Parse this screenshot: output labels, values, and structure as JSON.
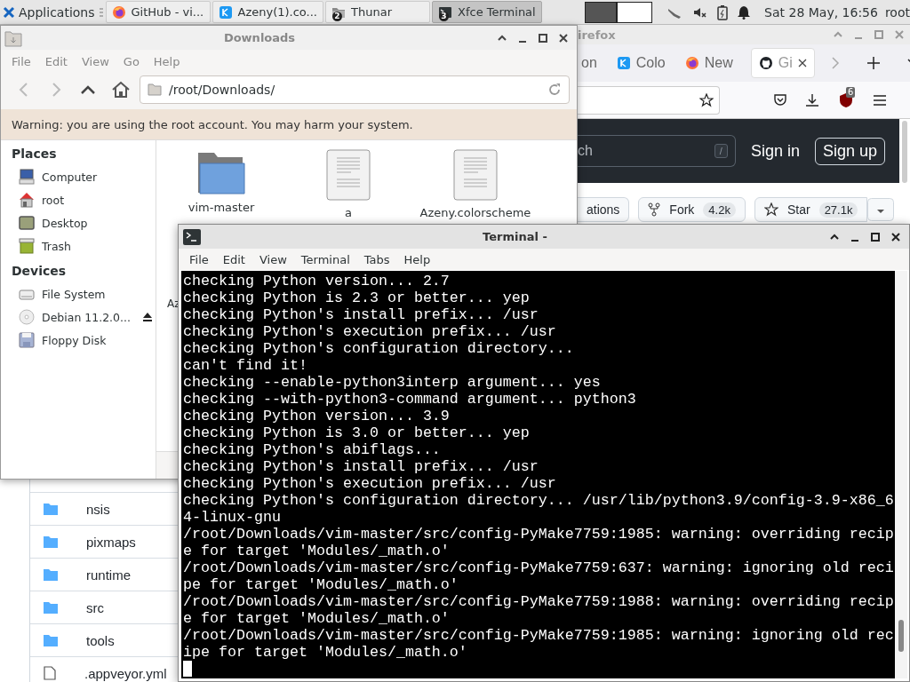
{
  "panel": {
    "menu_label": "Applications",
    "tasks": [
      {
        "label": "GitHub - vi...",
        "kind": "firefox",
        "selected": false
      },
      {
        "label": "Azeny(1).co...",
        "kind": "kde",
        "selected": false
      },
      {
        "label": "Thunar",
        "kind": "folder",
        "badge": "2",
        "selected": false
      },
      {
        "label": "Xfce Terminal",
        "kind": "terminal",
        "badge": "3",
        "selected": true
      }
    ],
    "clock": "Sat 28 May, 16:56",
    "user": "root"
  },
  "firefox": {
    "title": "irefox",
    "tabs": [
      {
        "label": "on",
        "kind": "none",
        "selected": false
      },
      {
        "label": "Colo",
        "kind": "kde",
        "selected": false
      },
      {
        "label": "New",
        "kind": "firefox",
        "selected": false
      },
      {
        "label": "Gi",
        "kind": "github",
        "selected": true
      }
    ],
    "extension_badge": "6",
    "header": {
      "search_placeholder": "ch",
      "search_key": "/",
      "sign_in": "Sign in",
      "sign_up": "Sign up"
    },
    "repo_actions": [
      {
        "label": "ations",
        "kind": "plain"
      },
      {
        "label": "Fork",
        "kind": "fork",
        "count": "4.2k"
      },
      {
        "label": "Star",
        "kind": "star",
        "count": "27.1k"
      }
    ],
    "files": [
      {
        "name": "nsis",
        "kind": "folder"
      },
      {
        "name": "pixmaps",
        "kind": "folder"
      },
      {
        "name": "runtime",
        "kind": "folder"
      },
      {
        "name": "src",
        "kind": "folder"
      },
      {
        "name": "tools",
        "kind": "folder"
      },
      {
        "name": ".appveyor.yml",
        "kind": "file"
      }
    ]
  },
  "thunar": {
    "title": "Downloads",
    "menu": [
      "File",
      "Edit",
      "View",
      "Go",
      "Help"
    ],
    "location": "/root/Downloads/",
    "warning": "Warning: you are using the root account. You may harm your system.",
    "sidebar": [
      {
        "heading": "Places",
        "items": [
          {
            "label": "Computer",
            "kind": "computer",
            "eject": false
          },
          {
            "label": "root",
            "kind": "home",
            "eject": false
          },
          {
            "label": "Desktop",
            "kind": "desktop",
            "eject": false
          },
          {
            "label": "Trash",
            "kind": "trash",
            "eject": false
          }
        ]
      },
      {
        "heading": "Devices",
        "items": [
          {
            "label": "File System",
            "kind": "drive",
            "eject": false
          },
          {
            "label": "Debian 11.2.0...",
            "kind": "disc",
            "eject": true
          },
          {
            "label": "Floppy Disk",
            "kind": "floppy",
            "eject": false
          }
        ]
      }
    ],
    "files": [
      {
        "name": "vim-master",
        "kind": "folder"
      },
      {
        "name": "a",
        "kind": "document"
      },
      {
        "name": "Azeny.colorscheme",
        "kind": "document"
      },
      {
        "name": "Az",
        "kind": "hidden"
      }
    ]
  },
  "terminal": {
    "title": "Terminal -",
    "menu": [
      "File",
      "Edit",
      "View",
      "Terminal",
      "Tabs",
      "Help"
    ],
    "lines": [
      "checking Python version... 2.7",
      "checking Python is 2.3 or better... yep",
      "checking Python's install prefix... /usr",
      "checking Python's execution prefix... /usr",
      "checking Python's configuration directory...",
      "can't find it!",
      "checking --enable-python3interp argument... yes",
      "checking --with-python3-command argument... python3",
      "checking Python version... 3.9",
      "checking Python is 3.0 or better... yep",
      "checking Python's abiflags...",
      "checking Python's install prefix... /usr",
      "checking Python's execution prefix... /usr",
      "checking Python's configuration directory... /usr/lib/python3.9/config-3.9-x86_6",
      "4-linux-gnu",
      "/root/Downloads/vim-master/src/config-PyMake7759:1985: warning: overriding recip",
      "e for target 'Modules/_math.o'",
      "/root/Downloads/vim-master/src/config-PyMake7759:637: warning: ignoring old reci",
      "pe for target 'Modules/_math.o'",
      "/root/Downloads/vim-master/src/config-PyMake7759:1988: warning: overriding recip",
      "e for target 'Modules/_math.o'",
      "/root/Downloads/vim-master/src/config-PyMake7759:1985: warning: ignoring old rec",
      "ipe for target 'Modules/_math.o'"
    ]
  }
}
